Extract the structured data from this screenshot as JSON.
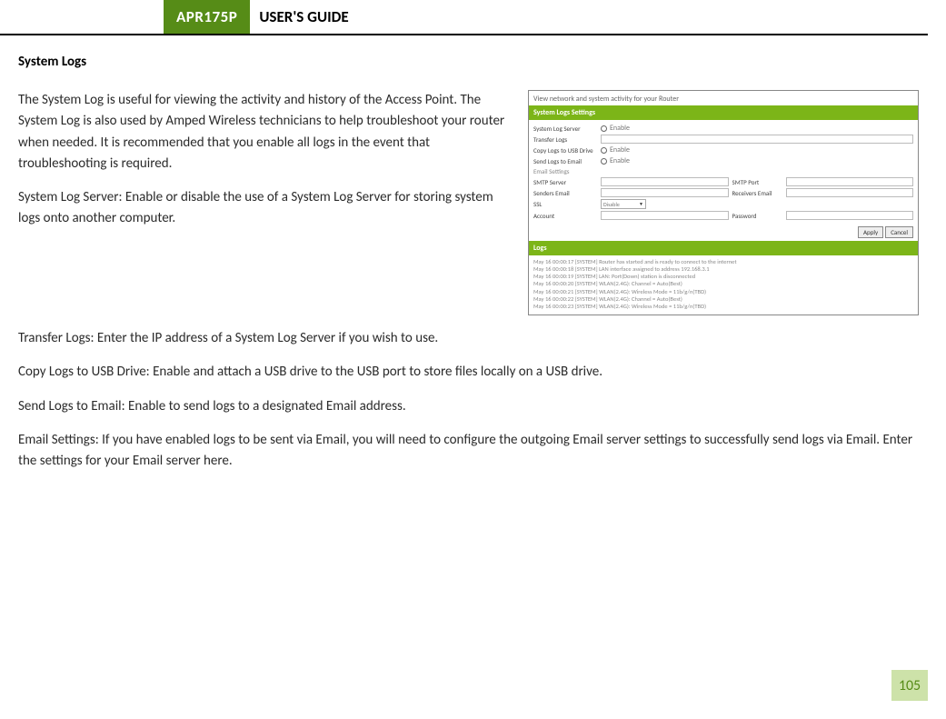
{
  "header": {
    "model": "APR175P",
    "title": "USER'S GUIDE"
  },
  "section": {
    "title": "System Logs"
  },
  "paragraphs": {
    "intro": "The System Log is useful for viewing the activity and history of the Access Point.  The System Log is also used by Amped Wireless technicians to help troubleshoot your router when needed.  It is recommended that you enable all logs in the event that troubleshooting is required.",
    "syslog_server": "System Log Server: Enable or disable the use of a System Log Server for storing system logs onto another computer.",
    "transfer_logs": "Transfer Logs: Enter the IP address of a System Log Server if you wish to use.",
    "copy_usb": "Copy Logs to USB Drive: Enable and attach a USB drive to the USB port to store files locally on a USB drive.",
    "send_email": "Send Logs to Email: Enable to send logs to a designated Email address.",
    "email_settings": "Email Settings:  If you have enabled logs to be sent via Email, you will need to configure the outgoing Email server settings to successfully send logs via Email.  Enter the settings for your Email server here."
  },
  "figure": {
    "caption": "View network and system activity for your Router",
    "settings_header": "System Logs Settings",
    "labels": {
      "syslog_server": "System Log Server",
      "transfer_logs": "Transfer Logs",
      "copy_usb": "Copy Logs to USB Drive",
      "send_email": "Send Logs to Email",
      "email_settings": "Email Settings",
      "smtp_server": "SMTP Server",
      "senders_email": "Senders Email",
      "ssl": "SSL",
      "account": "Account",
      "smtp_port": "SMTP Port",
      "receivers_email": "Receivers Email",
      "password": "Password"
    },
    "enable": "Enable",
    "select_value": "Disable",
    "buttons": {
      "apply": "Apply",
      "cancel": "Cancel"
    },
    "logs_header": "Logs",
    "log_lines": [
      "May 16 00:00:17 [SYSTEM] Router has started and is ready to connect to the internet",
      "May 16 00:00:18 [SYSTEM] LAN interface assigned to address 192.168.3.1",
      "May 16 00:00:19 [SYSTEM] LAN: Port(Down) station is disconnected",
      "May 16 00:00:20 [SYSTEM] WLAN(2.4G): Channel = Auto(Best)",
      "May 16 00:00:21 [SYSTEM] WLAN(2.4G): Wireless Mode = 11b/g/n(TBD)",
      "May 16 00:00:22 [SYSTEM] WLAN(2.4G): Channel = Auto(Best)",
      "May 16 00:00:23 [SYSTEM] WLAN(2.4G): Wireless Mode = 11b/g/n(TBD)"
    ]
  },
  "page_number": "105"
}
